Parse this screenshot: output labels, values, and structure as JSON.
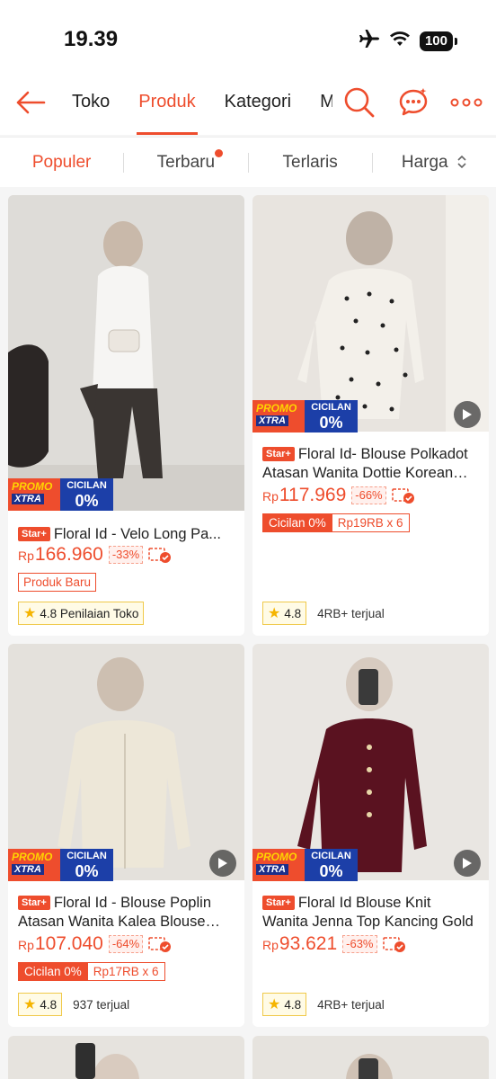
{
  "status": {
    "time": "19.39",
    "battery": "100"
  },
  "nav": {
    "tabs": [
      {
        "label": "Toko"
      },
      {
        "label": "Produk"
      },
      {
        "label": "Kategori"
      },
      {
        "label": "Me"
      }
    ],
    "active_tab": "Produk"
  },
  "filters": [
    {
      "label": "Populer"
    },
    {
      "label": "Terbaru"
    },
    {
      "label": "Terlaris"
    },
    {
      "label": "Harga"
    }
  ],
  "promo": {
    "line1": "PROMO",
    "line2": "XTRA",
    "cicilan": "CICILAN",
    "zero": "0%"
  },
  "star_badge": "Star+",
  "products": [
    {
      "title": "Floral Id - Velo Long Pa...",
      "currency": "Rp",
      "price": "166.960",
      "discount": "-33%",
      "tag": "Produk Baru",
      "rating": "4.8 Penilaian Toko",
      "sold": ""
    },
    {
      "title": "Floral Id- Blouse Polkadot Atasan Wanita Dottie Korean Style",
      "currency": "Rp",
      "price": "117.969",
      "discount": "-66%",
      "cicilan_label": "Cicilan 0%",
      "cicilan_amount": "Rp19RB x 6",
      "rating": "4.8",
      "sold": "4RB+ terjual"
    },
    {
      "title": "Floral Id - Blouse Poplin Atasan Wanita Kalea Blouse Ruffle",
      "currency": "Rp",
      "price": "107.040",
      "discount": "-64%",
      "cicilan_label": "Cicilan 0%",
      "cicilan_amount": "Rp17RB x 6",
      "rating": "4.8",
      "sold": "937 terjual"
    },
    {
      "title": "Floral Id Blouse Knit Wanita Jenna Top Kancing Gold",
      "currency": "Rp",
      "price": "93.621",
      "discount": "-63%",
      "rating": "4.8",
      "sold": "4RB+ terjual"
    }
  ],
  "colors": {
    "accent": "#ee4d2d",
    "promo_blue": "#1c3fa8"
  }
}
